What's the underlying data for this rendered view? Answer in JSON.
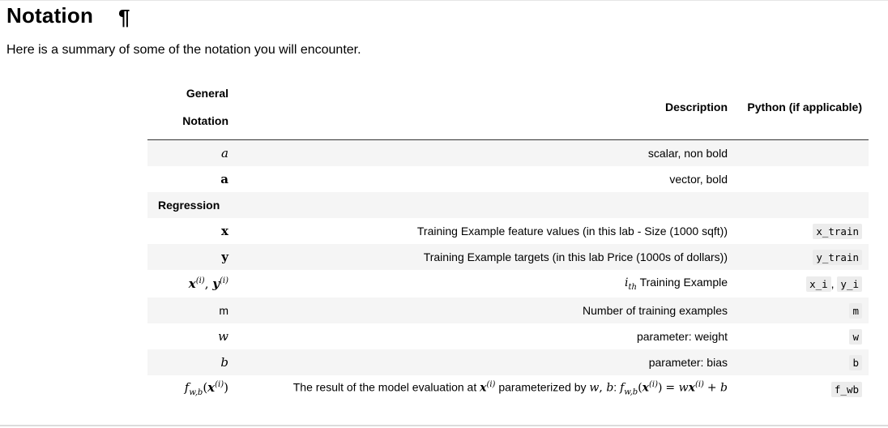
{
  "heading": {
    "title": "Notation",
    "anchor": "¶"
  },
  "intro": "Here is a summary of some of the notation you will encounter.",
  "table": {
    "headers": {
      "general": "General",
      "notation": "Notation",
      "description": "Description",
      "python": "Python (if applicable)"
    },
    "rows": [
      {
        "notation": "a",
        "description": "scalar, non bold",
        "python": ""
      },
      {
        "notation": "a",
        "description": "vector, bold",
        "python": ""
      },
      {
        "section": "Regression"
      },
      {
        "notation": "x",
        "description": "Training Example feature values (in this lab - Size (1000 sqft))",
        "python": "x_train"
      },
      {
        "notation": "y",
        "description": "Training Example targets (in this lab Price (1000s of dollars))",
        "python": "y_train"
      },
      {
        "notation_a": "x",
        "notation_b": "y",
        "sup": "(i)",
        "sep": ",",
        "desc_math": "i",
        "desc_sub": "th",
        "description": "Training Example",
        "python_a": "x_i",
        "python_sep": ",",
        "python_b": "y_i"
      },
      {
        "notation": "m",
        "description": "Number of training examples",
        "python": "m"
      },
      {
        "notation": "w",
        "description": "parameter: weight",
        "python": "w"
      },
      {
        "notation": "b",
        "description": "parameter: bias",
        "python": "b"
      },
      {
        "notation_f": "f",
        "notation_sub": "w,b",
        "notation_x": "x",
        "sup": "(i)",
        "description_1": "The result of the model evaluation at",
        "description_2": "parameterized by",
        "param_w": "w",
        "param_b": "b",
        "equation_rhs_1": "= w",
        "equation_rhs_2": "+ b",
        "python": "f_wb"
      }
    ]
  }
}
